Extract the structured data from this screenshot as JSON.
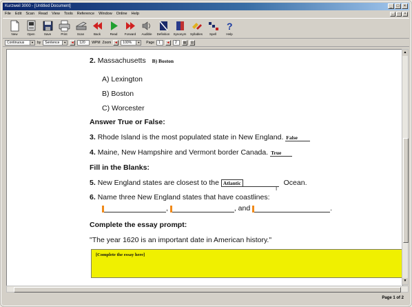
{
  "window": {
    "title": "Kurzweil 3000 - [Untitled Document]"
  },
  "window_buttons": [
    "_",
    "□",
    "×"
  ],
  "menu": [
    "File",
    "Edit",
    "Scan",
    "Read",
    "View",
    "Tools",
    "Reference",
    "Window",
    "Online",
    "Help"
  ],
  "toolbar": [
    {
      "icon": "new-icon",
      "label": "New"
    },
    {
      "icon": "open-icon",
      "label": "Open"
    },
    {
      "icon": "save-icon",
      "label": "Save"
    },
    {
      "icon": "print-icon",
      "label": "Print"
    },
    {
      "icon": "scan-icon",
      "label": "Scan"
    },
    {
      "icon": "back-icon",
      "label": "Back"
    },
    {
      "icon": "read-icon",
      "label": "Read"
    },
    {
      "icon": "forward-icon",
      "label": "Forward"
    },
    {
      "icon": "audible-icon",
      "label": "Audible"
    },
    {
      "icon": "definition-icon",
      "label": "Definition"
    },
    {
      "icon": "synonym-icon",
      "label": "Synonym"
    },
    {
      "icon": "syllables-icon",
      "label": "Syllables"
    },
    {
      "icon": "spell-icon",
      "label": "Spell"
    },
    {
      "icon": "help-icon",
      "label": "Help"
    }
  ],
  "formatbar": {
    "mode": "Continuous",
    "by_label": "by",
    "unit": "Sentence",
    "speed": "120",
    "speed_unit": "WPM",
    "zoom_label": "Zoom",
    "zoom": "100%",
    "page_label": "Page",
    "page": "1",
    "page_total": "2"
  },
  "doc": {
    "q2": {
      "num": "2.",
      "text": "Massachusetts",
      "answer": "B) Boston"
    },
    "options": [
      "A) Lexington",
      "B) Boston",
      "C) Worcester"
    ],
    "section_tf": "Answer True or False:",
    "q3": {
      "num": "3.",
      "text": "Rhode Island is the most populated state in New England.",
      "answer": "False"
    },
    "q4": {
      "num": "4.",
      "text": "Maine, New Hampshire and Vermont border Canada.",
      "answer": "True"
    },
    "section_fill": "Fill in the Blanks:",
    "q5": {
      "num": "5.",
      "before": "New England states are closest to the",
      "answer": "Atlantic",
      "after": "Ocean."
    },
    "q6": {
      "num": "6.",
      "text": "Name three New England states that have coastlines:",
      "sep1": ",",
      "and": ", and",
      "end": "."
    },
    "section_essay": "Complete the essay prompt:",
    "prompt": "\"The year 1620 is an important date in American history.\"",
    "essay_placeholder": "[Complete the essay here]"
  },
  "status": {
    "page": "Page 1 of 2"
  },
  "colors": {
    "essay_bg": "#f0f000",
    "cursor": "#f08a1a",
    "titlebar": "#0a246a"
  }
}
